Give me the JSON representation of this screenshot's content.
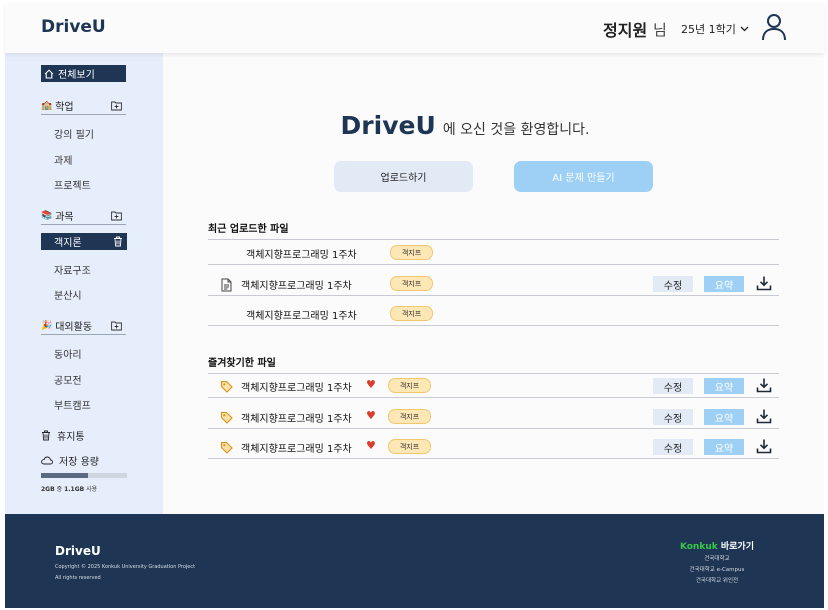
{
  "header": {
    "logo": "DriveU",
    "user_name": "정지원",
    "user_suffix": "님",
    "semester": "25년 1학기"
  },
  "sidebar": {
    "all_view": "전체보기",
    "sections": [
      {
        "title": "학업",
        "emoji": "🏫",
        "items": [
          "강의 필기",
          "과제",
          "프로젝트"
        ]
      },
      {
        "title": "과목",
        "emoji": "📚",
        "items": [
          "객지론",
          "자료구조",
          "분산시"
        ],
        "active": "객지론"
      },
      {
        "title": "대외활동",
        "emoji": "🎉",
        "items": [
          "동아리",
          "공모전",
          "부트캠프"
        ]
      }
    ],
    "trash": "휴지통",
    "storage_label": "저장 용량",
    "storage_used": "2GB",
    "storage_mid": "중",
    "storage_total": "1.1GB",
    "storage_suffix": "사용",
    "storage_fraction": 0.55
  },
  "main": {
    "welcome_brand": "DriveU",
    "welcome_rest": "에 오신 것을 환영합니다.",
    "upload_button": "업로드하기",
    "ai_button": "AI 문제 만들기",
    "recent_title": "최근 업로드한 파일",
    "recent_files": [
      {
        "name": "객체지향프로그래밍 1주차",
        "tag": "객지프",
        "hover": false
      },
      {
        "name": "객체지향프로그래밍 1주차",
        "tag": "객지프",
        "hover": true
      },
      {
        "name": "객체지향프로그래밍 1주차",
        "tag": "객지프",
        "hover": false
      }
    ],
    "favorite_title": "즐겨찾기한 파일",
    "favorite_files": [
      {
        "name": "객체지향프로그래밍 1주차",
        "tag": "객지프"
      },
      {
        "name": "객체지향프로그래밍 1주차",
        "tag": "객지프"
      },
      {
        "name": "객체지향프로그래밍 1주차",
        "tag": "객지프"
      }
    ],
    "edit_label": "수정",
    "summary_label": "요약"
  },
  "footer": {
    "logo": "DriveU",
    "copyright": "Copyright © 2025 Konkuk University Graduation Project",
    "rights": "All rights reserved",
    "shortcut_brand": "Konkuk",
    "shortcut_label": "바로가기",
    "links": [
      "건국대학교",
      "건국대학교 e-Campus",
      "건국대학교 위인전"
    ]
  },
  "colors": {
    "navy": "#1e3553",
    "sidebar_bg": "#e7eefb",
    "accent_blue": "#9ed0f5",
    "tag_bg": "#fde7b5",
    "heart": "#dc3c2e",
    "konkuk_green": "#38c94a"
  },
  "icons": [
    "home-icon",
    "folder-plus-icon",
    "trash-icon",
    "cloud-icon",
    "user-icon",
    "chevron-down-icon",
    "document-icon",
    "tag-icon",
    "heart-icon",
    "download-icon"
  ]
}
